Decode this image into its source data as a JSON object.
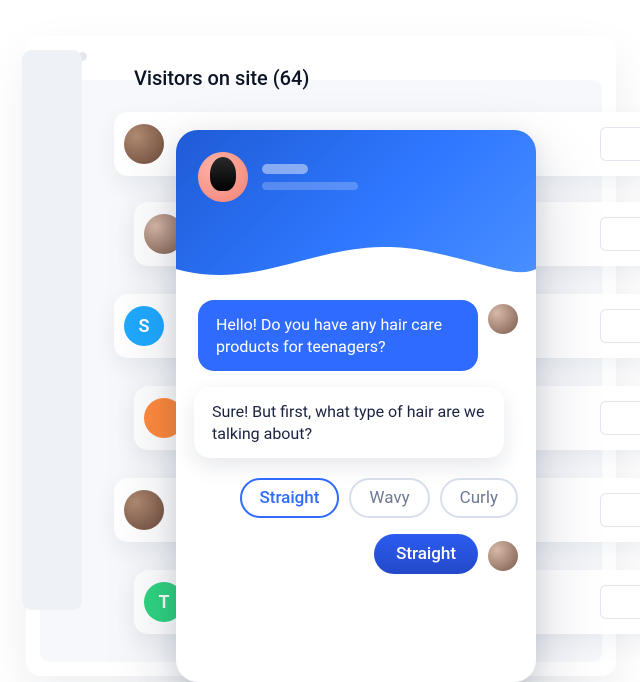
{
  "header": {
    "title": "Visitors on site (64)"
  },
  "visitor_rows": [
    {
      "initial": ""
    },
    {
      "initial": ""
    },
    {
      "initial": "S"
    },
    {
      "initial": ""
    },
    {
      "initial": ""
    },
    {
      "initial": "T"
    }
  ],
  "chat": {
    "visitor_message": "Hello! Do you have any hair care products for teenagers?",
    "agent_message": "Sure! But first, what type of hair are we talking about?",
    "options": {
      "opt1": "Straight",
      "opt2": "Wavy",
      "opt3": "Curly"
    },
    "selected": "Straight"
  },
  "colors": {
    "brand_blue": "#2f6bff",
    "deep_blue": "#2349c9"
  }
}
